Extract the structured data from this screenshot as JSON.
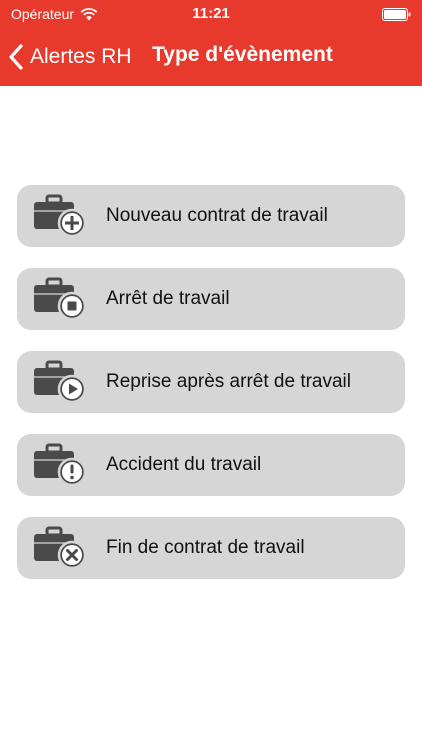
{
  "status_bar": {
    "carrier": "Opérateur",
    "time": "11:21"
  },
  "nav": {
    "back_label": "Alertes RH",
    "title": "Type d'évènement"
  },
  "colors": {
    "header": "#e7392c",
    "item_bg": "#d6d6d6",
    "icon": "#4a4a4a"
  },
  "events": [
    {
      "label": "Nouveau contrat de travail",
      "icon": "briefcase-plus-icon"
    },
    {
      "label": "Arrêt de travail",
      "icon": "briefcase-stop-icon"
    },
    {
      "label": "Reprise après arrêt de travail",
      "icon": "briefcase-play-icon"
    },
    {
      "label": "Accident du travail",
      "icon": "briefcase-alert-icon"
    },
    {
      "label": "Fin de contrat de travail",
      "icon": "briefcase-cancel-icon"
    }
  ]
}
